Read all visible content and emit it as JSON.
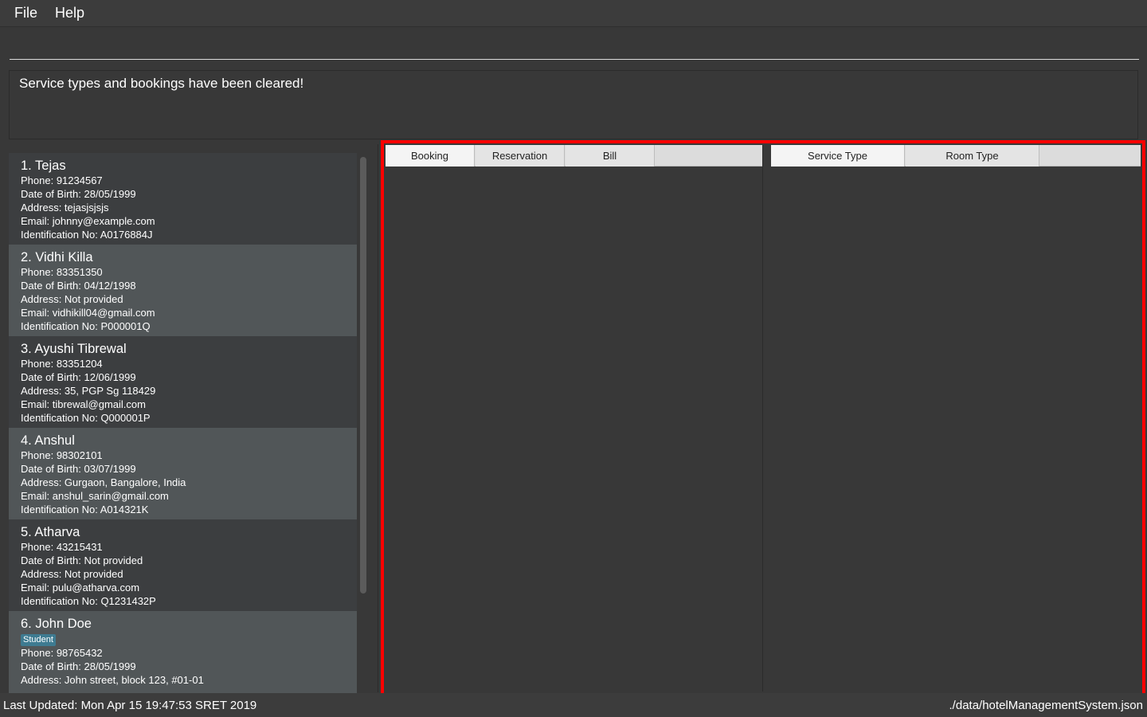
{
  "menu": {
    "file": "File",
    "help": "Help"
  },
  "command": {
    "value": ""
  },
  "result": "Service types and bookings have been cleared!",
  "persons": [
    {
      "name": "1.  Tejas",
      "tags": [],
      "lines": [
        "Phone: 91234567",
        "Date of Birth: 28/05/1999",
        "Address: tejasjsjsjs",
        "Email: johnny@example.com",
        "Identification No: A0176884J"
      ]
    },
    {
      "name": "2.  Vidhi Killa",
      "tags": [],
      "lines": [
        "Phone: 83351350",
        "Date of Birth: 04/12/1998",
        "Address: Not provided",
        "Email: vidhikill04@gmail.com",
        "Identification No: P000001Q"
      ]
    },
    {
      "name": "3.  Ayushi Tibrewal",
      "tags": [],
      "lines": [
        "Phone: 83351204",
        "Date of Birth: 12/06/1999",
        "Address: 35, PGP Sg 118429",
        "Email: tibrewal@gmail.com",
        "Identification No: Q000001P"
      ]
    },
    {
      "name": "4.  Anshul",
      "tags": [],
      "lines": [
        "Phone: 98302101",
        "Date of Birth: 03/07/1999",
        "Address: Gurgaon, Bangalore, India",
        "Email: anshul_sarin@gmail.com",
        "Identification No: A014321K"
      ]
    },
    {
      "name": "5.  Atharva",
      "tags": [],
      "lines": [
        "Phone: 43215431",
        "Date of Birth: Not provided",
        "Address: Not provided",
        "Email: pulu@atharva.com",
        "Identification No: Q1231432P"
      ]
    },
    {
      "name": "6.  John Doe",
      "tags": [
        "Student"
      ],
      "lines": [
        "Phone: 98765432",
        "Date of Birth: 28/05/1999",
        "Address: John street, block 123, #01-01"
      ]
    }
  ],
  "left_tabs": [
    {
      "label": "Booking",
      "selected": true
    },
    {
      "label": "Reservation",
      "selected": false
    },
    {
      "label": "Bill",
      "selected": false
    }
  ],
  "right_tabs": [
    {
      "label": "Service Type",
      "selected": true
    },
    {
      "label": "Room Type",
      "selected": false
    }
  ],
  "status": {
    "last_updated": "Last Updated: Mon Apr 15 19:47:53 SRET 2019",
    "file_path": "./data/hotelManagementSystem.json"
  },
  "colors": {
    "highlight": "#ff0000",
    "tag": "#3e7b91"
  }
}
